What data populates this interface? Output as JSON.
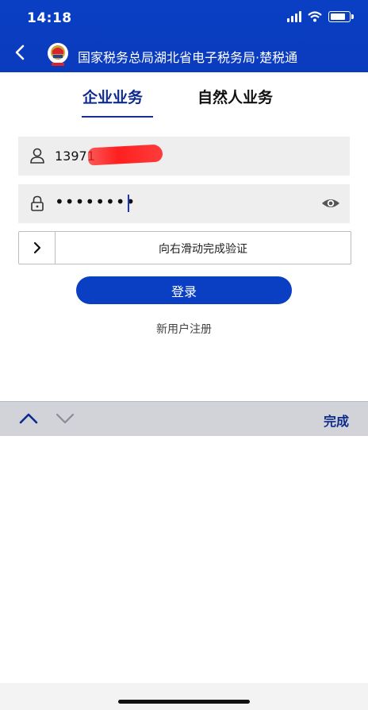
{
  "status_bar": {
    "time": "14:18"
  },
  "nav": {
    "title": "国家税务总局湖北省电子税务局·楚税通",
    "emblem_icon": "tax-emblem-icon",
    "back_icon": "chevron-left-icon"
  },
  "tabs": [
    {
      "label": "企业业务",
      "active": true
    },
    {
      "label": "自然人业务",
      "active": false
    }
  ],
  "form": {
    "username": {
      "value": "13971",
      "icon": "user-icon",
      "redacted": true
    },
    "password": {
      "value": "••••••••",
      "icon": "lock-icon",
      "toggle_icon": "eye-icon"
    },
    "slider": {
      "label": "向右滑动完成验证",
      "handle_icon": "chevron-right-icon"
    },
    "login_label": "登录",
    "register_label": "新用户注册"
  },
  "keyboard_toolbar": {
    "up_icon": "chevron-up-icon",
    "down_icon": "chevron-down-icon",
    "done_label": "完成"
  },
  "colors": {
    "brand_blue": "#0a3fc4",
    "active_tab": "#0d2a8c",
    "field_bg": "#eeeeef",
    "toolbar_bg": "#d1d3d9"
  }
}
